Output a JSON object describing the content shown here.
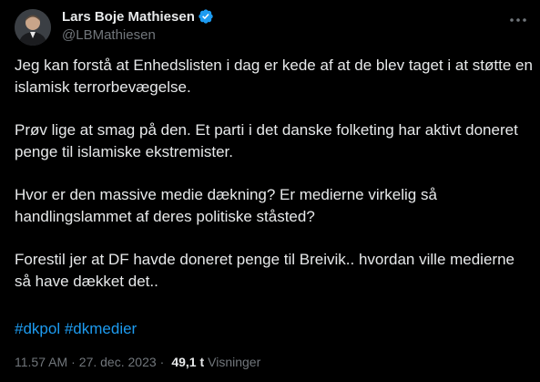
{
  "author": {
    "display_name": "Lars Boje Mathiesen",
    "handle": "@LBMathiesen",
    "verified_icon": "verified-badge-icon"
  },
  "tweet": {
    "paragraphs": [
      "Jeg kan forstå at Enhedslisten i dag er kede af at de blev taget i at støtte en islamisk terrorbevægelse.",
      "Prøv lige at smag på den. Et parti i det danske folketing har aktivt doneret penge til islamiske ekstremister.",
      "Hvor er den massive medie dækning? Er medierne virkelig så handlingslammet af deres politiske ståsted?",
      "Forestil jer at DF havde doneret penge til Breivik.. hvordan ville medierne så have dækket det.."
    ],
    "hashtags": [
      "#dkpol",
      "#dkmedier"
    ]
  },
  "meta": {
    "time": "11.57 AM",
    "separator": "·",
    "date": "27. dec. 2023",
    "views_count": "49,1 t",
    "views_label": "Visninger"
  },
  "colors": {
    "background": "#000000",
    "text": "#e7e9ea",
    "muted": "#71767b",
    "accent": "#1d9bf0"
  }
}
